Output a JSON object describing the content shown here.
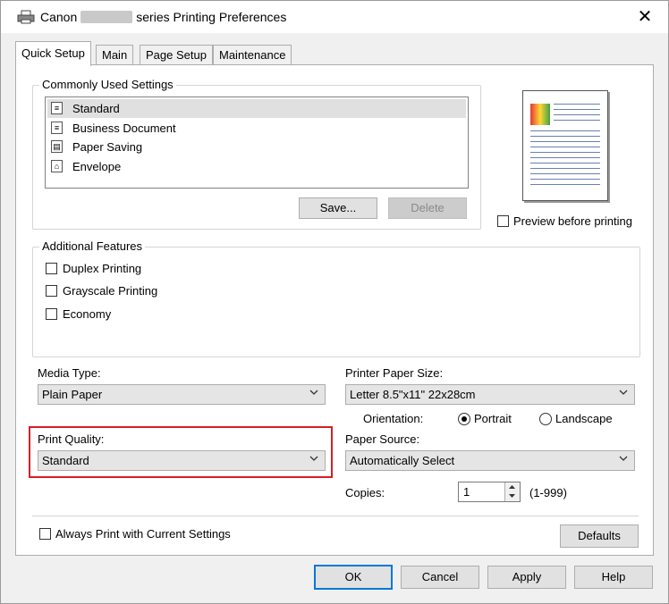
{
  "window": {
    "title_prefix": "Canon",
    "title_suffix": "series Printing Preferences",
    "close_glyph": "✕"
  },
  "tabs": [
    {
      "label": "Quick Setup",
      "active": true
    },
    {
      "label": "Main",
      "active": false
    },
    {
      "label": "Page Setup",
      "active": false
    },
    {
      "label": "Maintenance",
      "active": false
    }
  ],
  "commonly_used": {
    "legend": "Commonly Used Settings",
    "items": [
      {
        "label": "Standard",
        "icon": "standard-doc-icon",
        "selected": true
      },
      {
        "label": "Business Document",
        "icon": "business-doc-icon",
        "selected": false
      },
      {
        "label": "Paper Saving",
        "icon": "paper-saving-icon",
        "selected": false
      },
      {
        "label": "Envelope",
        "icon": "envelope-icon",
        "selected": false
      }
    ],
    "save_label": "Save...",
    "delete_label": "Delete"
  },
  "preview": {
    "checkbox_label": "Preview before printing",
    "checked": false
  },
  "additional_features": {
    "legend": "Additional Features",
    "items": [
      {
        "label": "Duplex Printing",
        "checked": false
      },
      {
        "label": "Grayscale Printing",
        "checked": false
      },
      {
        "label": "Economy",
        "checked": false
      }
    ]
  },
  "media_type": {
    "label": "Media Type:",
    "value": "Plain Paper"
  },
  "print_quality": {
    "label": "Print Quality:",
    "value": "Standard"
  },
  "printer_paper_size": {
    "label": "Printer Paper Size:",
    "value": "Letter 8.5\"x11\" 22x28cm"
  },
  "orientation": {
    "label": "Orientation:",
    "portrait": "Portrait",
    "landscape": "Landscape",
    "selected": "Portrait"
  },
  "paper_source": {
    "label": "Paper Source:",
    "value": "Automatically Select"
  },
  "copies": {
    "label": "Copies:",
    "value": "1",
    "range": "(1-999)"
  },
  "always_print": {
    "label": "Always Print with Current Settings",
    "checked": false
  },
  "defaults_label": "Defaults",
  "footer": {
    "ok": "OK",
    "cancel": "Cancel",
    "apply": "Apply",
    "help": "Help"
  },
  "colors": {
    "highlight": "#d51f26",
    "focus": "#0078d7"
  }
}
